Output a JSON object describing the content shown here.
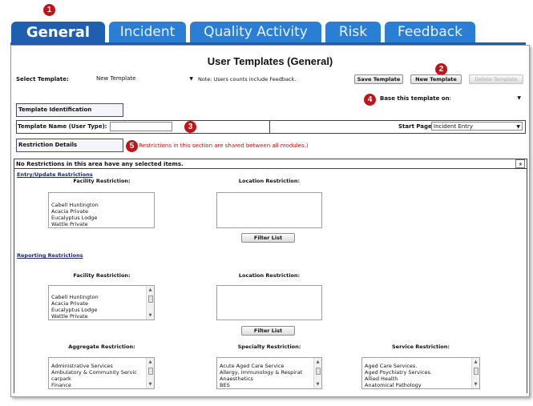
{
  "callouts": [
    "1",
    "2",
    "3",
    "4",
    "5"
  ],
  "tabs": [
    {
      "label": "General",
      "active": true
    },
    {
      "label": "Incident"
    },
    {
      "label": "Quality Activity"
    },
    {
      "label": "Risk"
    },
    {
      "label": "Feedback"
    }
  ],
  "page_title": "User Templates (General)",
  "select_template": {
    "label": "Select Template:",
    "value": "New Template",
    "note": "Note: Users counts include Feedback."
  },
  "buttons": {
    "save": "Save Template",
    "new": "New Template",
    "delete": "Delete Template"
  },
  "base_template": {
    "label": "Base this template on:",
    "value": ""
  },
  "template_identification": "Template Identification",
  "template_name": {
    "label": "Template Name (User Type):",
    "value": ""
  },
  "start_page": {
    "label": "Start Page:",
    "value": "Incident Entry"
  },
  "restriction_details": "Restriction Details",
  "restriction_note": "Restrictions in this section are shared between all modules.)",
  "no_restrictions": "No Restrictions in this area have any selected items.",
  "collapse_symbol": "»",
  "entry_update": {
    "heading": "Entry/Update Restrictions",
    "facility_label": "Facility Restriction:",
    "location_label": "Location Restriction:",
    "facilities": [
      "Cabell Huntington",
      "Acacia Private",
      "Eucalyptus Lodge",
      "Wattle Private"
    ],
    "filter_button": "Filter List"
  },
  "reporting": {
    "heading": "Reporting Restrictions",
    "facility_label": "Facility Restriction:",
    "location_label": "Location Restriction:",
    "facilities": [
      "Cabell Huntington",
      "Acacia Private",
      "Eucalyptus Lodge",
      "Wattle Private"
    ],
    "filter_button": "Filter List",
    "aggregate_label": "Aggregate Restriction:",
    "aggregates": [
      "Administrative Services",
      "Ambulatory & Community Servic",
      "carpark",
      "Finance"
    ],
    "specialty_label": "Specialty Restriction:",
    "specialties": [
      "Acute Aged Care Service",
      "Allergy, Immunology & Respirat",
      "Anaesthetics",
      "BES"
    ],
    "service_label": "Service Restriction:",
    "services": [
      "Aged Care Services.",
      "Aged Psychiatry Services.",
      "Allied Health",
      "Anatomical Pathology"
    ]
  },
  "colors": {
    "tab_active": "#1f5fb0",
    "tab": "#2a7fd4",
    "callout": "#c0141b",
    "note_red": "#d01010"
  }
}
